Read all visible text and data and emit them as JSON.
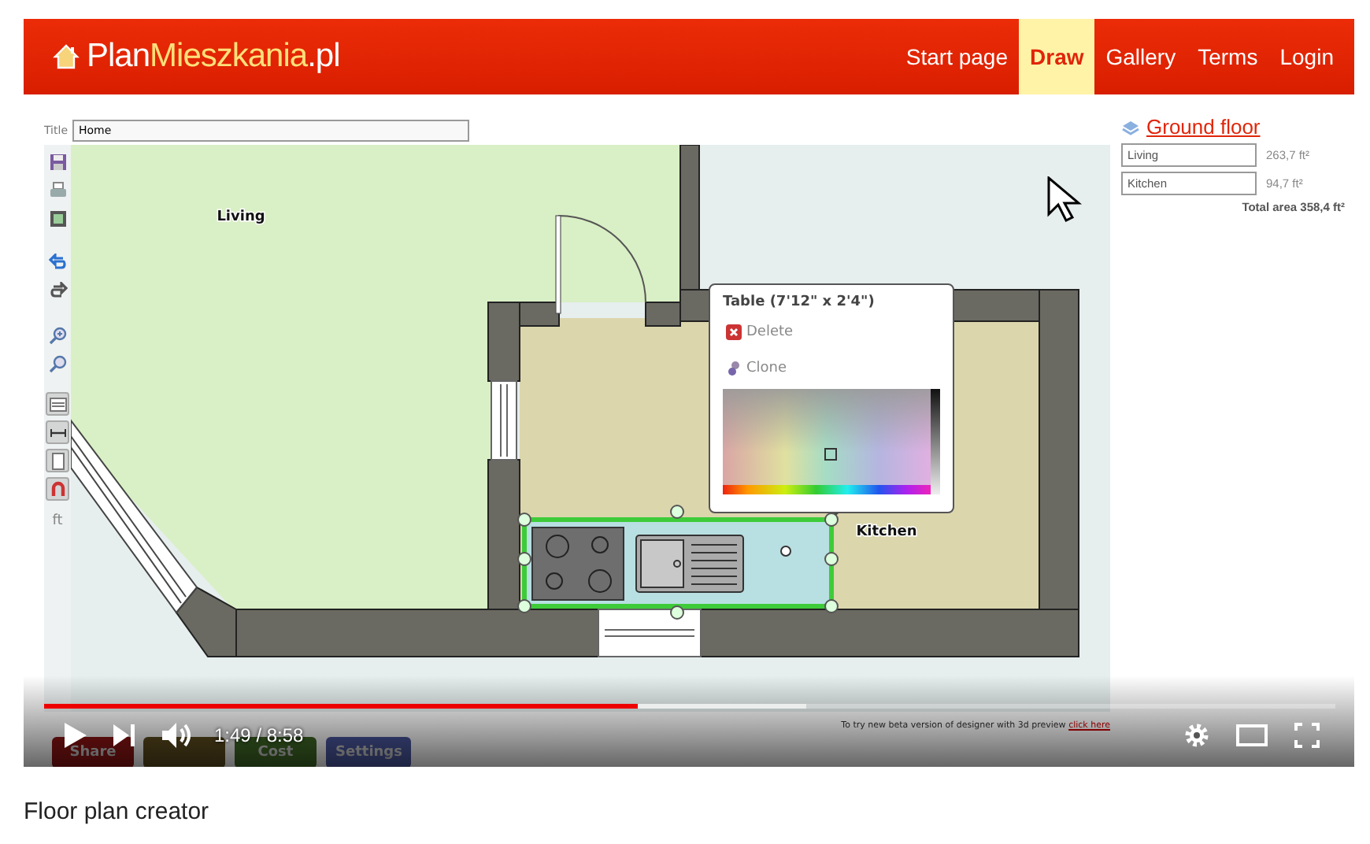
{
  "video": {
    "app": {
      "logo": {
        "parts": [
          {
            "text": "Plan",
            "color": "#ffffff"
          },
          {
            "text": "Mieszkania",
            "color": "#ffe07a"
          },
          {
            "text": ".pl",
            "color": "#ffffff"
          }
        ]
      },
      "nav": [
        {
          "label": "Start page",
          "selected": false
        },
        {
          "label": "Draw",
          "selected": true
        },
        {
          "label": "Gallery",
          "selected": false
        },
        {
          "label": "Terms",
          "selected": false
        },
        {
          "label": "Login",
          "selected": false
        }
      ],
      "title_field": {
        "label": "Title",
        "value": "Home"
      },
      "tools": [
        {
          "kind": "save"
        },
        {
          "kind": "print"
        },
        {
          "kind": "image"
        },
        {
          "kind": "undo"
        },
        {
          "kind": "redo"
        },
        {
          "kind": "zoom-in"
        },
        {
          "kind": "zoom-out"
        },
        {
          "kind": "grid"
        },
        {
          "kind": "measure"
        },
        {
          "kind": "page"
        },
        {
          "kind": "magnet"
        }
      ],
      "unit": "ft",
      "plan": {
        "rooms": [
          {
            "name": "Living"
          },
          {
            "name": "Kitchen"
          }
        ]
      },
      "context_menu": {
        "title": "Table (7'12\" x 2'4\")",
        "items": [
          {
            "kind": "delete",
            "label": "Delete"
          },
          {
            "kind": "clone",
            "label": "Clone"
          }
        ]
      },
      "floor": {
        "title": "Ground floor",
        "rooms": [
          {
            "name": "Living",
            "area": "263,7 ft²"
          },
          {
            "name": "Kitchen",
            "area": "94,7 ft²"
          }
        ],
        "total": "Total area 358,4 ft²"
      },
      "beta_note": {
        "text": "To try new beta version of designer with 3d preview",
        "link": "click here"
      },
      "bottom_buttons": [
        {
          "label": "Share"
        },
        {
          "covered": true
        },
        {
          "label": "Cost"
        },
        {
          "label": "Settings"
        }
      ]
    },
    "player": {
      "progress": {
        "level": 0.46
      },
      "buffer": {
        "level": 0.59
      },
      "time": "1:49 / 8:58"
    }
  },
  "caption": "Floor plan creator"
}
